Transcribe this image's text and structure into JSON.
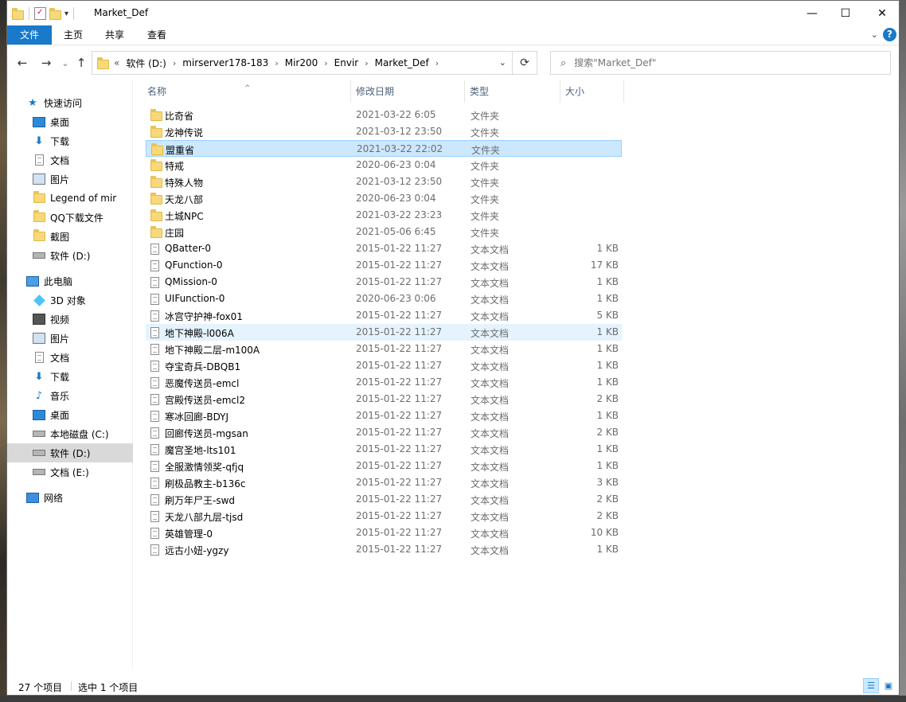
{
  "window": {
    "title": "Market_Def",
    "minimize": "—",
    "maximize": "☐",
    "close": "✕"
  },
  "ribbon": {
    "tabs": [
      "文件",
      "主页",
      "共享",
      "查看"
    ],
    "help": "?"
  },
  "nav": {
    "back": "←",
    "forward": "→",
    "recent": "⌄",
    "up": "↑",
    "overflow": "«",
    "breadcrumbs": [
      "软件 (D:)",
      "mirserver178-183",
      "Mir200",
      "Envir",
      "Market_Def"
    ],
    "search_placeholder": "搜索\"Market_Def\""
  },
  "sidebar": {
    "items": [
      {
        "label": "快速访问",
        "icon": "star-icon"
      },
      {
        "label": "桌面",
        "icon": "desktop-icon",
        "pinned": true
      },
      {
        "label": "下载",
        "icon": "download-icon",
        "pinned": true
      },
      {
        "label": "文档",
        "icon": "document-icon",
        "pinned": true
      },
      {
        "label": "图片",
        "icon": "pictures-icon",
        "pinned": true
      },
      {
        "label": "Legend of mir",
        "icon": "folder-icon"
      },
      {
        "label": "QQ下载文件",
        "icon": "folder-icon"
      },
      {
        "label": "截图",
        "icon": "folder-icon"
      },
      {
        "label": "软件 (D:)",
        "icon": "drive-icon"
      },
      {
        "label": "此电脑",
        "icon": "computer-icon"
      },
      {
        "label": "3D 对象",
        "icon": "3d-objects-icon"
      },
      {
        "label": "视频",
        "icon": "videos-icon"
      },
      {
        "label": "图片",
        "icon": "pictures-icon"
      },
      {
        "label": "文档",
        "icon": "document-icon"
      },
      {
        "label": "下载",
        "icon": "download-icon"
      },
      {
        "label": "音乐",
        "icon": "music-icon"
      },
      {
        "label": "桌面",
        "icon": "desktop-icon"
      },
      {
        "label": "本地磁盘 (C:)",
        "icon": "drive-icon"
      },
      {
        "label": "软件 (D:)",
        "icon": "drive-icon"
      },
      {
        "label": "文档 (E:)",
        "icon": "drive-icon"
      },
      {
        "label": "网络",
        "icon": "network-icon"
      }
    ]
  },
  "columns": {
    "name": "名称",
    "date": "修改日期",
    "type": "类型",
    "size": "大小"
  },
  "files": [
    {
      "name": "比奇省",
      "date": "2021-03-22 6:05",
      "type": "文件夹",
      "size": "",
      "kind": "folder"
    },
    {
      "name": "龙神传说",
      "date": "2021-03-12 23:50",
      "type": "文件夹",
      "size": "",
      "kind": "folder"
    },
    {
      "name": "盟重省",
      "date": "2021-03-22 22:02",
      "type": "文件夹",
      "size": "",
      "kind": "folder"
    },
    {
      "name": "特戒",
      "date": "2020-06-23 0:04",
      "type": "文件夹",
      "size": "",
      "kind": "folder"
    },
    {
      "name": "特殊人物",
      "date": "2021-03-12 23:50",
      "type": "文件夹",
      "size": "",
      "kind": "folder"
    },
    {
      "name": "天龙八部",
      "date": "2020-06-23 0:04",
      "type": "文件夹",
      "size": "",
      "kind": "folder"
    },
    {
      "name": "土城NPC",
      "date": "2021-03-22 23:23",
      "type": "文件夹",
      "size": "",
      "kind": "folder"
    },
    {
      "name": "庄园",
      "date": "2021-05-06 6:45",
      "type": "文件夹",
      "size": "",
      "kind": "folder"
    },
    {
      "name": "QBatter-0",
      "date": "2015-01-22 11:27",
      "type": "文本文档",
      "size": "1 KB",
      "kind": "doc"
    },
    {
      "name": "QFunction-0",
      "date": "2015-01-22 11:27",
      "type": "文本文档",
      "size": "17 KB",
      "kind": "doc"
    },
    {
      "name": "QMission-0",
      "date": "2015-01-22 11:27",
      "type": "文本文档",
      "size": "1 KB",
      "kind": "doc"
    },
    {
      "name": "UIFunction-0",
      "date": "2020-06-23 0:06",
      "type": "文本文档",
      "size": "1 KB",
      "kind": "doc"
    },
    {
      "name": "冰宫守护神-fox01",
      "date": "2015-01-22 11:27",
      "type": "文本文档",
      "size": "5 KB",
      "kind": "doc"
    },
    {
      "name": "地下神殿-l006A",
      "date": "2015-01-22 11:27",
      "type": "文本文档",
      "size": "1 KB",
      "kind": "doc"
    },
    {
      "name": "地下神殿二层-m100A",
      "date": "2015-01-22 11:27",
      "type": "文本文档",
      "size": "1 KB",
      "kind": "doc"
    },
    {
      "name": "夺宝奇兵-DBQB1",
      "date": "2015-01-22 11:27",
      "type": "文本文档",
      "size": "1 KB",
      "kind": "doc"
    },
    {
      "name": "恶魔传送员-emcl",
      "date": "2015-01-22 11:27",
      "type": "文本文档",
      "size": "1 KB",
      "kind": "doc"
    },
    {
      "name": "宫殿传送员-emcl2",
      "date": "2015-01-22 11:27",
      "type": "文本文档",
      "size": "2 KB",
      "kind": "doc"
    },
    {
      "name": "寒冰回廊-BDYJ",
      "date": "2015-01-22 11:27",
      "type": "文本文档",
      "size": "1 KB",
      "kind": "doc"
    },
    {
      "name": "回廊传送员-mgsan",
      "date": "2015-01-22 11:27",
      "type": "文本文档",
      "size": "2 KB",
      "kind": "doc"
    },
    {
      "name": "魔宫圣地-lts101",
      "date": "2015-01-22 11:27",
      "type": "文本文档",
      "size": "1 KB",
      "kind": "doc"
    },
    {
      "name": "全服激情领奖-qfjq",
      "date": "2015-01-22 11:27",
      "type": "文本文档",
      "size": "1 KB",
      "kind": "doc"
    },
    {
      "name": "刷极品教主-b136c",
      "date": "2015-01-22 11:27",
      "type": "文本文档",
      "size": "3 KB",
      "kind": "doc"
    },
    {
      "name": "刷万年尸王-swd",
      "date": "2015-01-22 11:27",
      "type": "文本文档",
      "size": "2 KB",
      "kind": "doc"
    },
    {
      "name": "天龙八部九层-tjsd",
      "date": "2015-01-22 11:27",
      "type": "文本文档",
      "size": "2 KB",
      "kind": "doc"
    },
    {
      "name": "英雄管理-0",
      "date": "2015-01-22 11:27",
      "type": "文本文档",
      "size": "10 KB",
      "kind": "doc"
    },
    {
      "name": "远古小妞-ygzy",
      "date": "2015-01-22 11:27",
      "type": "文本文档",
      "size": "1 KB",
      "kind": "doc"
    }
  ],
  "selected_row": 2,
  "hover_row": 13,
  "status": {
    "item_count": "27 个项目",
    "selection": "选中 1 个项目"
  },
  "colors": {
    "accent": "#1979ca",
    "selection": "#cce8ff",
    "hover": "#e5f3ff"
  }
}
